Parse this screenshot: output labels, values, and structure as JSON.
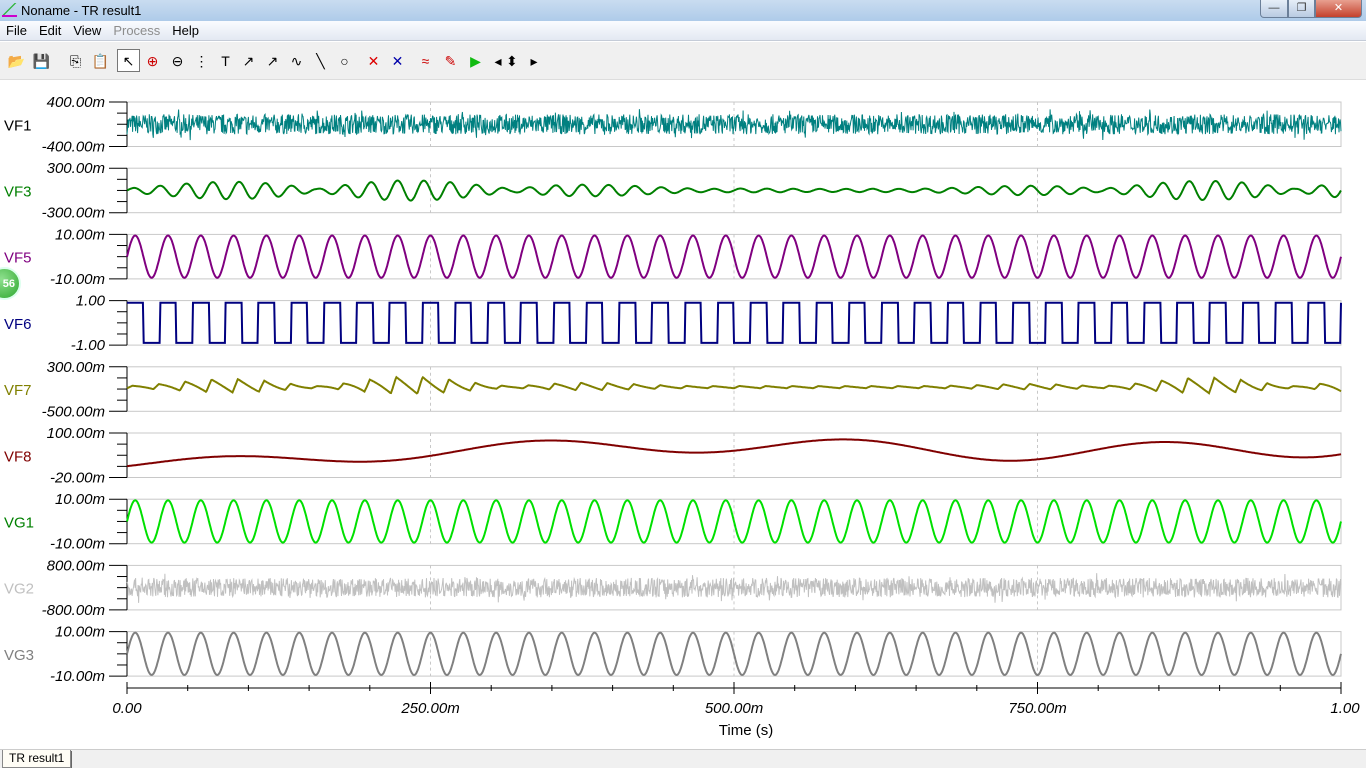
{
  "window": {
    "title": "Noname - TR result1",
    "minimize": "—",
    "restore": "❐",
    "close": "✕"
  },
  "menu": [
    "File",
    "Edit",
    "View",
    "Process",
    "Help"
  ],
  "toolbar": [
    {
      "name": "open-icon",
      "glyph": "📂"
    },
    {
      "name": "save-icon",
      "glyph": "💾"
    },
    {
      "name": "copy-icon",
      "glyph": "⎘"
    },
    {
      "name": "paste-icon",
      "glyph": "📋"
    },
    {
      "name": "pointer-icon",
      "glyph": "↖"
    },
    {
      "name": "zoom-in-icon",
      "glyph": "⊕"
    },
    {
      "name": "zoom-100-icon",
      "glyph": "⊖"
    },
    {
      "name": "grid-icon",
      "glyph": "⋮"
    },
    {
      "name": "text-icon",
      "glyph": "T"
    },
    {
      "name": "label-arrow-icon",
      "glyph": "↗"
    },
    {
      "name": "label-query-icon",
      "glyph": "↗"
    },
    {
      "name": "curve-label-icon",
      "glyph": "∿"
    },
    {
      "name": "line-icon",
      "glyph": "╲"
    },
    {
      "name": "circle-icon",
      "glyph": "○"
    },
    {
      "name": "cursor-a-icon",
      "glyph": "✕"
    },
    {
      "name": "cursor-b-icon",
      "glyph": "✕"
    },
    {
      "name": "add-curve-icon",
      "glyph": "≈"
    },
    {
      "name": "probe-icon",
      "glyph": "✎"
    },
    {
      "name": "run-icon",
      "glyph": "▶"
    },
    {
      "name": "left-arrow-icon",
      "glyph": "◂"
    },
    {
      "name": "up-down-arrow-icon",
      "glyph": "⬍"
    },
    {
      "name": "right-arrow-icon",
      "glyph": "▸"
    }
  ],
  "badge": "56",
  "tab": "TR result1",
  "chart_data": {
    "type": "line",
    "xlabel": "Time (s)",
    "xlim": [
      0,
      1
    ],
    "xticks": [
      {
        "v": 0,
        "label": "0.00"
      },
      {
        "v": 0.25,
        "label": "250.00m"
      },
      {
        "v": 0.5,
        "label": "500.00m"
      },
      {
        "v": 0.75,
        "label": "750.00m"
      },
      {
        "v": 1,
        "label": "1.00"
      }
    ],
    "grid": "dashed vertical at major ticks",
    "series": [
      {
        "name": "VF1",
        "color": "#008080",
        "ymax": "400.00m",
        "ymin": "-400.00m",
        "ylim": [
          -0.4,
          0.4
        ],
        "kind": "noise",
        "amplitude": 0.18
      },
      {
        "name": "VF3",
        "color": "#008000",
        "ymax": "300.00m",
        "ymin": "-300.00m",
        "ylim": [
          -0.3,
          0.3
        ],
        "kind": "am",
        "cycles": 46,
        "amplitude": 0.14
      },
      {
        "name": "VF5",
        "color": "#800080",
        "ymax": "10.00m",
        "ymin": "-10.00m",
        "ylim": [
          -0.01,
          0.01
        ],
        "kind": "sine",
        "cycles": 37,
        "amplitude": 0.0095
      },
      {
        "name": "VF6",
        "color": "#000080",
        "ymax": "1.00",
        "ymin": "-1.00",
        "ylim": [
          -1,
          1
        ],
        "kind": "square",
        "cycles": 37,
        "amplitude": 0.9
      },
      {
        "name": "VF7",
        "color": "#808000",
        "ymax": "300.00m",
        "ymin": "-500.00m",
        "ylim": [
          -0.5,
          0.3
        ],
        "kind": "burst",
        "cycles": 46,
        "amplitude": 0.2
      },
      {
        "name": "VF8",
        "color": "#800000",
        "ymax": "100.00m",
        "ymin": "-20.00m",
        "ylim": [
          -0.02,
          0.1
        ],
        "kind": "slow"
      },
      {
        "name": "VG1",
        "color": "#00e000",
        "ymax": "10.00m",
        "ymin": "-10.00m",
        "ylim": [
          -0.01,
          0.01
        ],
        "kind": "sine",
        "cycles": 37,
        "amplitude": 0.0095
      },
      {
        "name": "VG2",
        "color": "#c0c0c0",
        "ymax": "800.00m",
        "ymin": "-800.00m",
        "ylim": [
          -0.8,
          0.8
        ],
        "kind": "noise",
        "amplitude": 0.35
      },
      {
        "name": "VG3",
        "color": "#808080",
        "ymax": "10.00m",
        "ymin": "-10.00m",
        "ylim": [
          -0.01,
          0.01
        ],
        "kind": "sine",
        "cycles": 37,
        "amplitude": 0.0095
      }
    ]
  }
}
